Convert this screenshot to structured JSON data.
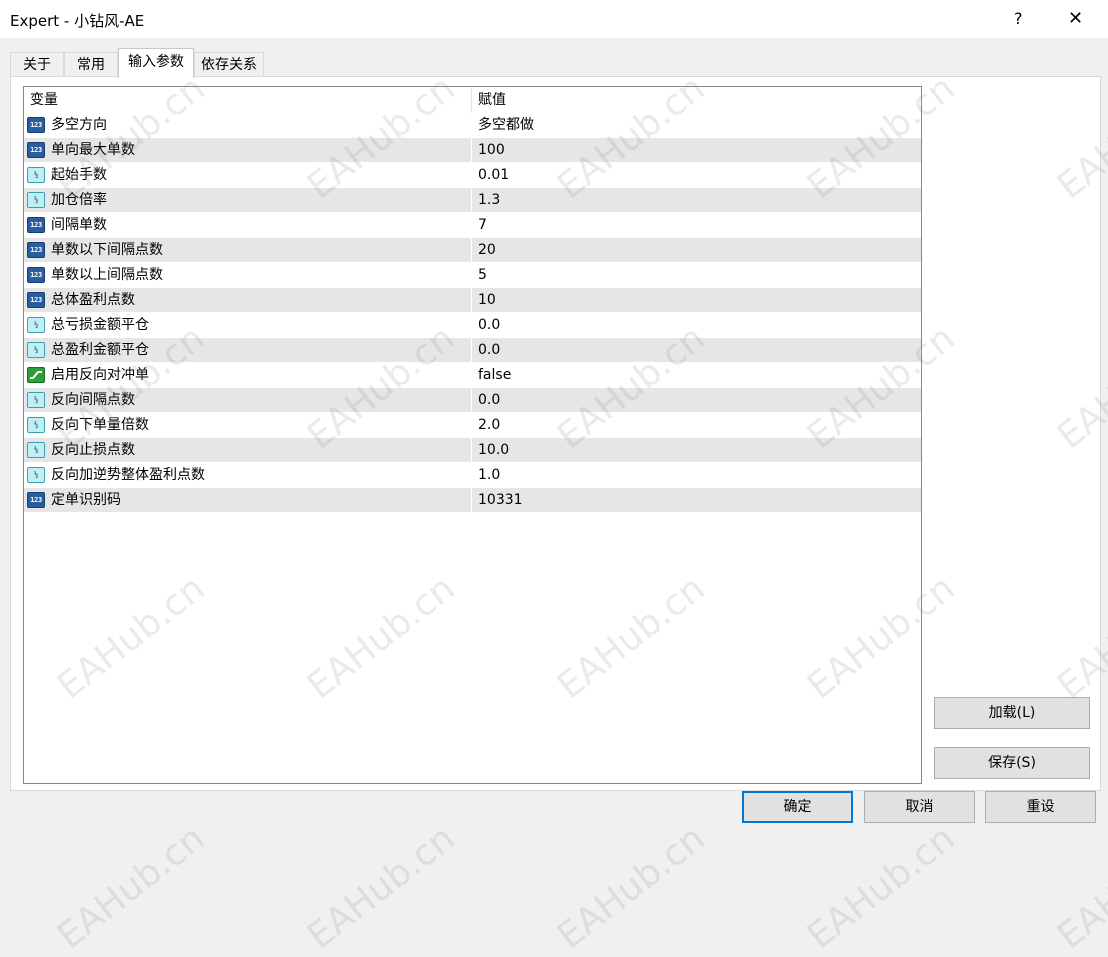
{
  "window": {
    "title": "Expert - 小钻风-AE",
    "help_glyph": "?",
    "close_glyph": "✕"
  },
  "tabs": [
    {
      "label": "关于",
      "active": false
    },
    {
      "label": "常用",
      "active": false
    },
    {
      "label": "输入参数",
      "active": true
    },
    {
      "label": "依存关系",
      "active": false
    }
  ],
  "grid": {
    "headers": {
      "variable": "变量",
      "value": "赋值"
    },
    "rows": [
      {
        "type": "int",
        "name": "多空方向",
        "value": "多空都做"
      },
      {
        "type": "int",
        "name": "单向最大单数",
        "value": "100"
      },
      {
        "type": "double",
        "name": "起始手数",
        "value": "0.01"
      },
      {
        "type": "double",
        "name": "加仓倍率",
        "value": "1.3"
      },
      {
        "type": "int",
        "name": "间隔单数",
        "value": "7"
      },
      {
        "type": "int",
        "name": "单数以下间隔点数",
        "value": "20"
      },
      {
        "type": "int",
        "name": "单数以上间隔点数",
        "value": "5"
      },
      {
        "type": "int",
        "name": "总体盈利点数",
        "value": "10"
      },
      {
        "type": "double",
        "name": "总亏损金额平仓",
        "value": "0.0"
      },
      {
        "type": "double",
        "name": "总盈利金额平仓",
        "value": "0.0"
      },
      {
        "type": "bool",
        "name": "启用反向对冲单",
        "value": "false"
      },
      {
        "type": "double",
        "name": "反向间隔点数",
        "value": "0.0"
      },
      {
        "type": "double",
        "name": "反向下单量倍数",
        "value": "2.0"
      },
      {
        "type": "double",
        "name": "反向止损点数",
        "value": "10.0"
      },
      {
        "type": "double",
        "name": "反向加逆势整体盈利点数",
        "value": "1.0"
      },
      {
        "type": "int",
        "name": "定单识别码",
        "value": "10331"
      }
    ]
  },
  "icons": {
    "int": {
      "name": "integer-type-icon",
      "glyph": "123"
    },
    "double": {
      "name": "double-type-icon",
      "glyph": "½"
    },
    "bool": {
      "name": "boolean-type-icon"
    }
  },
  "side_buttons": {
    "load": "加载(L)",
    "save": "保存(S)"
  },
  "footer_buttons": {
    "ok": "确定",
    "cancel": "取消",
    "reset": "重设"
  },
  "watermark": "EAHub.cn",
  "colors": {
    "accent": "#0078d7",
    "alt_row": "#e6e6e6"
  }
}
